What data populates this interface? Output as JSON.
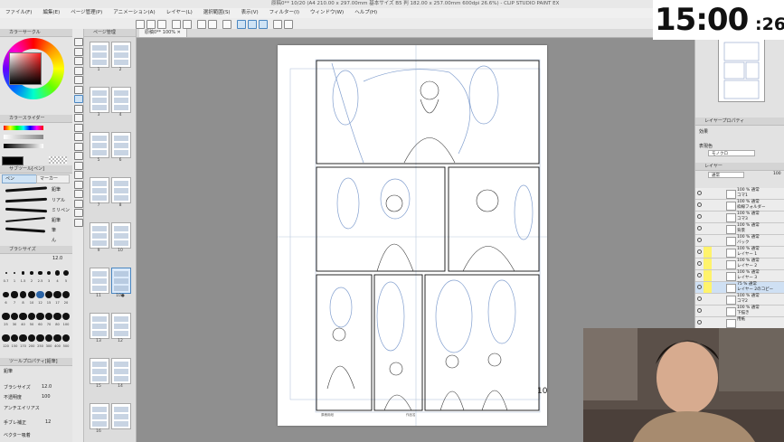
{
  "window": {
    "title": "原稿0** 10/20 (A4 210.00 x 297.00mm 基本サイズ B5 判 182.00 x 257.00mm 600dpi 26.6%) - CLIP STUDIO PAINT EX"
  },
  "menu": [
    "ファイル(F)",
    "編集(E)",
    "ページ管理(P)",
    "アニメーション(A)",
    "レイヤー(L)",
    "選択範囲(S)",
    "表示(V)",
    "フィルター(I)",
    "ウィンドウ(W)",
    "ヘルプ(H)"
  ],
  "clock": {
    "main": "15:00",
    "seconds": ":26"
  },
  "canvas": {
    "tab_label": "原稿0**",
    "zoom_label": "100%",
    "page_number": "10",
    "page_footer_left": "原稿用紙",
    "page_footer_right": "作品名"
  },
  "left_panel": {
    "color_header": "カラーサークル",
    "slider_header": "カラースライダー",
    "subtool_header": "サブツール[ペン]",
    "subtool_tabs": [
      "ペン",
      "マーカー"
    ],
    "brushes": [
      "鉛筆",
      "リアル",
      "ミリペン",
      "鉛筆",
      "筆",
      "ん"
    ],
    "brush_size_header": "ブラシサイズ",
    "brush_size_value": "12.0",
    "size_values": [
      "0.7",
      "1",
      "1.5",
      "2",
      "2.5",
      "3",
      "4",
      "5",
      "6",
      "7",
      "8",
      "10",
      "12",
      "15",
      "17",
      "20",
      "25",
      "30",
      "40",
      "50",
      "60",
      "70",
      "80",
      "100",
      "120",
      "150",
      "170",
      "200",
      "250",
      "300",
      "400",
      "500"
    ],
    "tool_property_header": "ツールプロパティ[鉛筆]",
    "properties": [
      {
        "label": "鉛筆",
        "value": ""
      },
      {
        "label": "ブラシサイズ",
        "value": "12.0"
      },
      {
        "label": "不透明度",
        "value": "100"
      },
      {
        "label": "アンチエイリアス",
        "value": ""
      },
      {
        "label": "手ブレ補正",
        "value": "12"
      },
      {
        "label": "ベクター吸着",
        "value": ""
      }
    ]
  },
  "pages_panel": {
    "header": "ページ管理",
    "thumbnails": [
      {
        "label": "1",
        "selected": false
      },
      {
        "label": "2",
        "selected": false
      },
      {
        "label": "3",
        "selected": false
      },
      {
        "label": "4",
        "selected": false
      },
      {
        "label": "5",
        "selected": false
      },
      {
        "label": "6",
        "selected": false
      },
      {
        "label": "7",
        "selected": false
      },
      {
        "label": "8",
        "selected": false
      },
      {
        "label": "9",
        "selected": false
      },
      {
        "label": "10",
        "selected": false
      },
      {
        "label": "11",
        "selected": false
      },
      {
        "label": "10●",
        "selected": true
      },
      {
        "label": "13",
        "selected": false
      },
      {
        "label": "12",
        "selected": false
      },
      {
        "label": "15",
        "selected": false
      },
      {
        "label": "14",
        "selected": false
      },
      {
        "label": "16",
        "selected": false
      },
      {
        "label": "",
        "selected": false
      }
    ]
  },
  "right_panel": {
    "layer_property_header": "レイヤープロパティ",
    "effect_label": "効果",
    "display_color_label": "表現色",
    "display_color_value": "モノクロ",
    "layer_header": "レイヤー",
    "blend_mode": "通常",
    "opacity": "100",
    "layers": [
      {
        "name": "100 % 通常\nコマ1",
        "marker": "",
        "selected": false
      },
      {
        "name": "100 % 通常\n枠線フォルダー",
        "marker": "",
        "selected": false
      },
      {
        "name": "100 % 通常\nコマ3",
        "marker": "",
        "selected": false
      },
      {
        "name": "100 % 通常\n背景",
        "marker": "",
        "selected": false
      },
      {
        "name": "100 % 通常\nバック",
        "marker": "",
        "selected": false
      },
      {
        "name": "100 % 通常\nレイヤー 1",
        "marker": "yellow",
        "selected": false
      },
      {
        "name": "100 % 通常\nレイヤー 2",
        "marker": "yellow",
        "selected": false
      },
      {
        "name": "100 % 通常\nレイヤー 3",
        "marker": "yellow",
        "selected": false
      },
      {
        "name": "75 % 通常\nレイヤー 2のコピー",
        "marker": "yellow",
        "selected": true
      },
      {
        "name": "100 % 通常\nコマ2",
        "marker": "",
        "selected": false
      },
      {
        "name": "100 % 通常\n下描き",
        "marker": "",
        "selected": false
      },
      {
        "name": "用紙",
        "marker": "",
        "selected": false
      }
    ]
  },
  "colors": {
    "accent": "#4a86c0",
    "layer_marker": "#fff36b",
    "selected_layer": "#cfe0f3"
  }
}
